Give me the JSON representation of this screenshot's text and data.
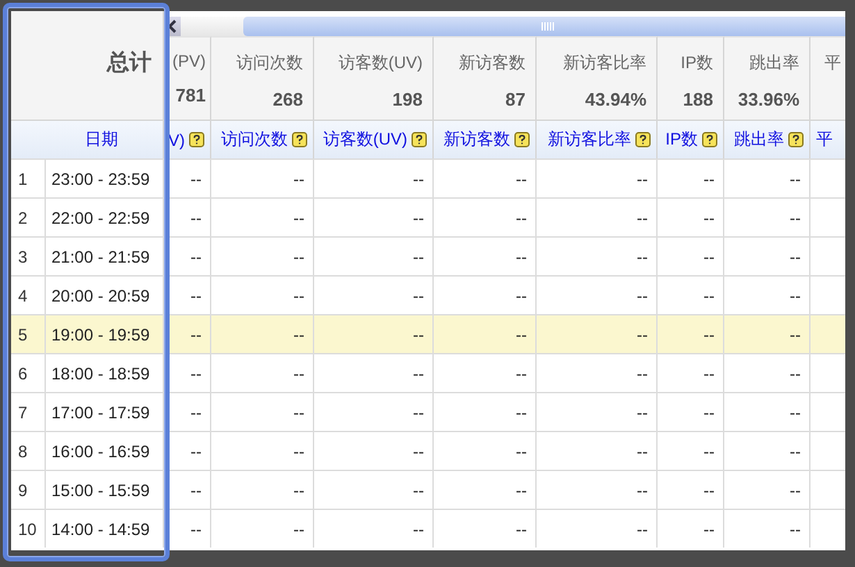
{
  "summary": {
    "label": "总计"
  },
  "columns": [
    {
      "header": "(PV)",
      "total": "781",
      "link": "V)"
    },
    {
      "header": "访问次数",
      "total": "268",
      "link": "访问次数"
    },
    {
      "header": "访客数(UV)",
      "total": "198",
      "link": "访客数(UV)"
    },
    {
      "header": "新访客数",
      "total": "87",
      "link": "新访客数"
    },
    {
      "header": "新访客比率",
      "total": "43.94%",
      "link": "新访客比率"
    },
    {
      "header": "IP数",
      "total": "188",
      "link": "IP数"
    },
    {
      "header": "跳出率",
      "total": "33.96%",
      "link": "跳出率"
    },
    {
      "header": "平",
      "link": "平"
    }
  ],
  "date_header": "日期",
  "rows": [
    {
      "index": "1",
      "date": "23:00 - 23:59",
      "highlighted": false,
      "values": [
        "--",
        "--",
        "--",
        "--",
        "--",
        "--",
        "--"
      ]
    },
    {
      "index": "2",
      "date": "22:00 - 22:59",
      "highlighted": false,
      "values": [
        "--",
        "--",
        "--",
        "--",
        "--",
        "--",
        "--"
      ]
    },
    {
      "index": "3",
      "date": "21:00 - 21:59",
      "highlighted": false,
      "values": [
        "--",
        "--",
        "--",
        "--",
        "--",
        "--",
        "--"
      ]
    },
    {
      "index": "4",
      "date": "20:00 - 20:59",
      "highlighted": false,
      "values": [
        "--",
        "--",
        "--",
        "--",
        "--",
        "--",
        "--"
      ]
    },
    {
      "index": "5",
      "date": "19:00 - 19:59",
      "highlighted": true,
      "values": [
        "--",
        "--",
        "--",
        "--",
        "--",
        "--",
        "--"
      ]
    },
    {
      "index": "6",
      "date": "18:00 - 18:59",
      "highlighted": false,
      "values": [
        "--",
        "--",
        "--",
        "--",
        "--",
        "--",
        "--"
      ]
    },
    {
      "index": "7",
      "date": "17:00 - 17:59",
      "highlighted": false,
      "values": [
        "--",
        "--",
        "--",
        "--",
        "--",
        "--",
        "--"
      ]
    },
    {
      "index": "8",
      "date": "16:00 - 16:59",
      "highlighted": false,
      "values": [
        "--",
        "--",
        "--",
        "--",
        "--",
        "--",
        "--"
      ]
    },
    {
      "index": "9",
      "date": "15:00 - 15:59",
      "highlighted": false,
      "values": [
        "--",
        "--",
        "--",
        "--",
        "--",
        "--",
        "--"
      ]
    },
    {
      "index": "10",
      "date": "14:00 - 14:59",
      "highlighted": false,
      "values": [
        "--",
        "--",
        "--",
        "--",
        "--",
        "--",
        "--"
      ]
    }
  ]
}
